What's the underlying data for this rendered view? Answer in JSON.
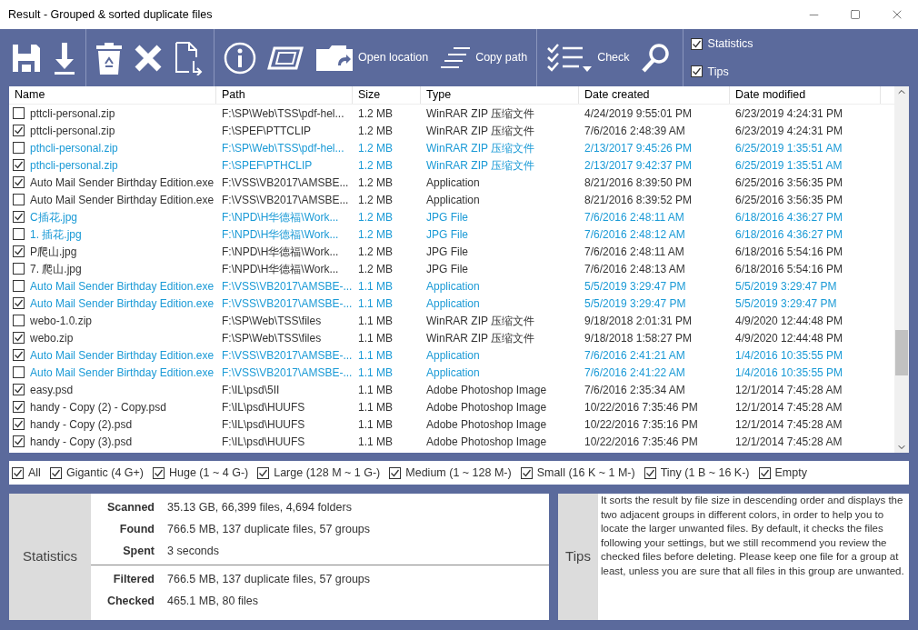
{
  "window": {
    "title": "Result - Grouped & sorted duplicate files"
  },
  "toolbar": {
    "buttons": [
      {
        "kind": "save"
      },
      {
        "kind": "download"
      },
      {
        "kind": "recycle",
        "group_start": true
      },
      {
        "kind": "delete"
      },
      {
        "kind": "export"
      },
      {
        "kind": "info",
        "group_start": true
      },
      {
        "kind": "frame"
      },
      {
        "kind": "folder",
        "label": "Open location"
      },
      {
        "kind": "lines",
        "label": "Copy path"
      },
      {
        "kind": "check",
        "label": "Check",
        "group_start": true
      },
      {
        "kind": "search"
      }
    ],
    "toggles": [
      {
        "label": "Statistics",
        "checked": true
      },
      {
        "label": "Tips",
        "checked": true
      }
    ]
  },
  "table": {
    "columns": [
      "Name",
      "Path",
      "Size",
      "Type",
      "Date created",
      "Date modified"
    ],
    "rows": [
      {
        "checked": false,
        "color": "#333333",
        "cells": [
          "pttcli-personal.zip",
          "F:\\SP\\Web\\TSS\\pdf-hel...",
          "1.2 MB",
          "WinRAR ZIP 压缩文件",
          "4/24/2019 9:55:01 PM",
          "6/23/2019 4:24:31 PM"
        ]
      },
      {
        "checked": true,
        "color": "#333333",
        "cells": [
          "pttcli-personal.zip",
          "F:\\SPEF\\PTTCLIP",
          "1.2 MB",
          "WinRAR ZIP 压缩文件",
          "7/6/2016 2:48:39 AM",
          "6/23/2019 4:24:31 PM"
        ]
      },
      {
        "checked": false,
        "color": "#1a9ad6",
        "cells": [
          "pthcli-personal.zip",
          "F:\\SP\\Web\\TSS\\pdf-hel...",
          "1.2 MB",
          "WinRAR ZIP 压缩文件",
          "2/13/2017 9:45:26 PM",
          "6/25/2019 1:35:51 AM"
        ]
      },
      {
        "checked": true,
        "color": "#1a9ad6",
        "cells": [
          "pthcli-personal.zip",
          "F:\\SPEF\\PTHCLIP",
          "1.2 MB",
          "WinRAR ZIP 压缩文件",
          "2/13/2017 9:42:37 PM",
          "6/25/2019 1:35:51 AM"
        ]
      },
      {
        "checked": true,
        "color": "#333333",
        "cells": [
          "Auto Mail Sender Birthday Edition.exe",
          "F:\\VSS\\VB2017\\AMSBE...",
          "1.2 MB",
          "Application",
          "8/21/2016 8:39:50 PM",
          "6/25/2016 3:56:35 PM"
        ]
      },
      {
        "checked": false,
        "color": "#333333",
        "cells": [
          "Auto Mail Sender Birthday Edition.exe",
          "F:\\VSS\\VB2017\\AMSBE...",
          "1.2 MB",
          "Application",
          "8/21/2016 8:39:52 PM",
          "6/25/2016 3:56:35 PM"
        ]
      },
      {
        "checked": true,
        "color": "#1a9ad6",
        "cells": [
          "C插花.jpg",
          "F:\\NPD\\H华德福\\Work...",
          "1.2 MB",
          "JPG File",
          "7/6/2016 2:48:11 AM",
          "6/18/2016 4:36:27 PM"
        ]
      },
      {
        "checked": false,
        "color": "#1a9ad6",
        "cells": [
          "1. 插花.jpg",
          "F:\\NPD\\H华德福\\Work...",
          "1.2 MB",
          "JPG File",
          "7/6/2016 2:48:12 AM",
          "6/18/2016 4:36:27 PM"
        ]
      },
      {
        "checked": true,
        "color": "#333333",
        "cells": [
          "P爬山.jpg",
          "F:\\NPD\\H华德福\\Work...",
          "1.2 MB",
          "JPG File",
          "7/6/2016 2:48:11 AM",
          "6/18/2016 5:54:16 PM"
        ]
      },
      {
        "checked": false,
        "color": "#333333",
        "cells": [
          "7. 爬山.jpg",
          "F:\\NPD\\H华德福\\Work...",
          "1.2 MB",
          "JPG File",
          "7/6/2016 2:48:13 AM",
          "6/18/2016 5:54:16 PM"
        ]
      },
      {
        "checked": false,
        "color": "#1a9ad6",
        "cells": [
          "Auto Mail Sender Birthday Edition.exe",
          "F:\\VSS\\VB2017\\AMSBE-...",
          "1.1 MB",
          "Application",
          "5/5/2019 3:29:47 PM",
          "5/5/2019 3:29:47 PM"
        ]
      },
      {
        "checked": true,
        "color": "#1a9ad6",
        "cells": [
          "Auto Mail Sender Birthday Edition.exe",
          "F:\\VSS\\VB2017\\AMSBE-...",
          "1.1 MB",
          "Application",
          "5/5/2019 3:29:47 PM",
          "5/5/2019 3:29:47 PM"
        ]
      },
      {
        "checked": false,
        "color": "#333333",
        "cells": [
          "webo-1.0.zip",
          "F:\\SP\\Web\\TSS\\files",
          "1.1 MB",
          "WinRAR ZIP 压缩文件",
          "9/18/2018 2:01:31 PM",
          "4/9/2020 12:44:48 PM"
        ]
      },
      {
        "checked": true,
        "color": "#333333",
        "cells": [
          "webo.zip",
          "F:\\SP\\Web\\TSS\\files",
          "1.1 MB",
          "WinRAR ZIP 压缩文件",
          "9/18/2018 1:58:27 PM",
          "4/9/2020 12:44:48 PM"
        ]
      },
      {
        "checked": true,
        "color": "#1a9ad6",
        "cells": [
          "Auto Mail Sender Birthday Edition.exe",
          "F:\\VSS\\VB2017\\AMSBE-...",
          "1.1 MB",
          "Application",
          "7/6/2016 2:41:21 AM",
          "1/4/2016 10:35:55 PM"
        ]
      },
      {
        "checked": false,
        "color": "#1a9ad6",
        "cells": [
          "Auto Mail Sender Birthday Edition.exe",
          "F:\\VSS\\VB2017\\AMSBE-...",
          "1.1 MB",
          "Application",
          "7/6/2016 2:41:22 AM",
          "1/4/2016 10:35:55 PM"
        ]
      },
      {
        "checked": true,
        "color": "#333333",
        "cells": [
          "easy.psd",
          "F:\\IL\\psd\\5II",
          "1.1 MB",
          "Adobe Photoshop Image",
          "7/6/2016 2:35:34 AM",
          "12/1/2014 7:45:28 AM"
        ]
      },
      {
        "checked": true,
        "color": "#333333",
        "cells": [
          "handy - Copy (2) - Copy.psd",
          "F:\\IL\\psd\\HUUFS",
          "1.1 MB",
          "Adobe Photoshop Image",
          "10/22/2016 7:35:46 PM",
          "12/1/2014 7:45:28 AM"
        ]
      },
      {
        "checked": true,
        "color": "#333333",
        "cells": [
          "handy - Copy (2).psd",
          "F:\\IL\\psd\\HUUFS",
          "1.1 MB",
          "Adobe Photoshop Image",
          "10/22/2016 7:35:16 PM",
          "12/1/2014 7:45:28 AM"
        ]
      },
      {
        "checked": true,
        "color": "#333333",
        "cells": [
          "handy - Copy (3).psd",
          "F:\\IL\\psd\\HUUFS",
          "1.1 MB",
          "Adobe Photoshop Image",
          "10/22/2016 7:35:46 PM",
          "12/1/2014 7:45:28 AM"
        ]
      }
    ]
  },
  "filters": [
    {
      "label": "All",
      "checked": true
    },
    {
      "label": "Gigantic (4 G+)",
      "checked": true
    },
    {
      "label": "Huge (1 ~ 4 G-)",
      "checked": true
    },
    {
      "label": "Large (128 M ~ 1 G-)",
      "checked": true
    },
    {
      "label": "Medium (1 ~ 128 M-)",
      "checked": true
    },
    {
      "label": "Small (16 K ~ 1 M-)",
      "checked": true
    },
    {
      "label": "Tiny (1 B ~ 16 K-)",
      "checked": true
    },
    {
      "label": "Empty",
      "checked": true
    }
  ],
  "statistics": {
    "title": "Statistics",
    "groups": [
      [
        {
          "label": "Scanned",
          "value": "35.13 GB, 66,399 files, 4,694 folders"
        },
        {
          "label": "Found",
          "value": "766.5 MB, 137 duplicate files, 57 groups"
        },
        {
          "label": "Spent",
          "value": "3 seconds"
        }
      ],
      [
        {
          "label": "Filtered",
          "value": "766.5 MB, 137 duplicate files, 57 groups"
        },
        {
          "label": "Checked",
          "value": "465.1 MB, 80 files"
        }
      ]
    ]
  },
  "tips": {
    "title": "Tips",
    "text": "It sorts the result by file size in descending order and displays the two adjacent groups in different colors, in order to help you to locate the larger unwanted files. By default, it checks the files following your settings, but we still recommend you review the checked files before deleting. Please keep one file for a group at least, unless you are sure that all files in this group are unwanted."
  }
}
